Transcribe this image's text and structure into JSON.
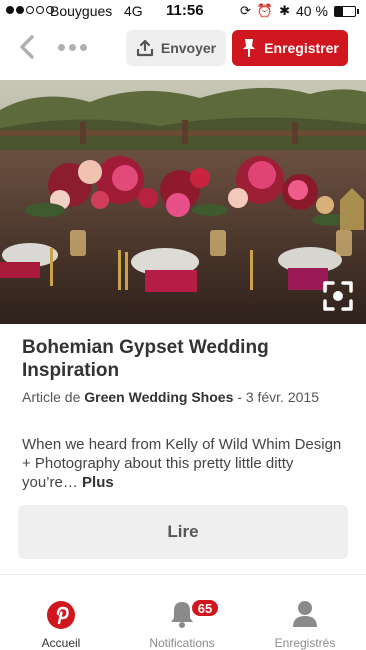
{
  "status_bar": {
    "carrier": "Bouygues",
    "network": "4G",
    "time": "11:56",
    "battery_percent": "40 %",
    "battery_level": 0.4,
    "signal_bars_filled": 2,
    "signal_bars_total": 5,
    "icons": [
      "rotation-lock-icon",
      "alarm-icon",
      "bluetooth-icon"
    ]
  },
  "nav": {
    "send_label": "Envoyer",
    "save_label": "Enregistrer"
  },
  "pin": {
    "title": "Bohemian Gypset Wedding Inspiration",
    "article_prefix": "Article de ",
    "source": "Green Wedding Shoes",
    "date_sep": " - ",
    "date": "3 févr. 2015",
    "description": "When we heard from Kelly of Wild Whim Design + Photography about this pretty little ditty you’re… ",
    "more_label": "Plus",
    "read_label": "Lire"
  },
  "tabbar": {
    "home_label": "Accueil",
    "notifications_label": "Notifications",
    "notifications_count": "65",
    "saved_label": "Enregistrés"
  },
  "colors": {
    "brand_red": "#d0171f",
    "button_gray": "#efefef"
  }
}
